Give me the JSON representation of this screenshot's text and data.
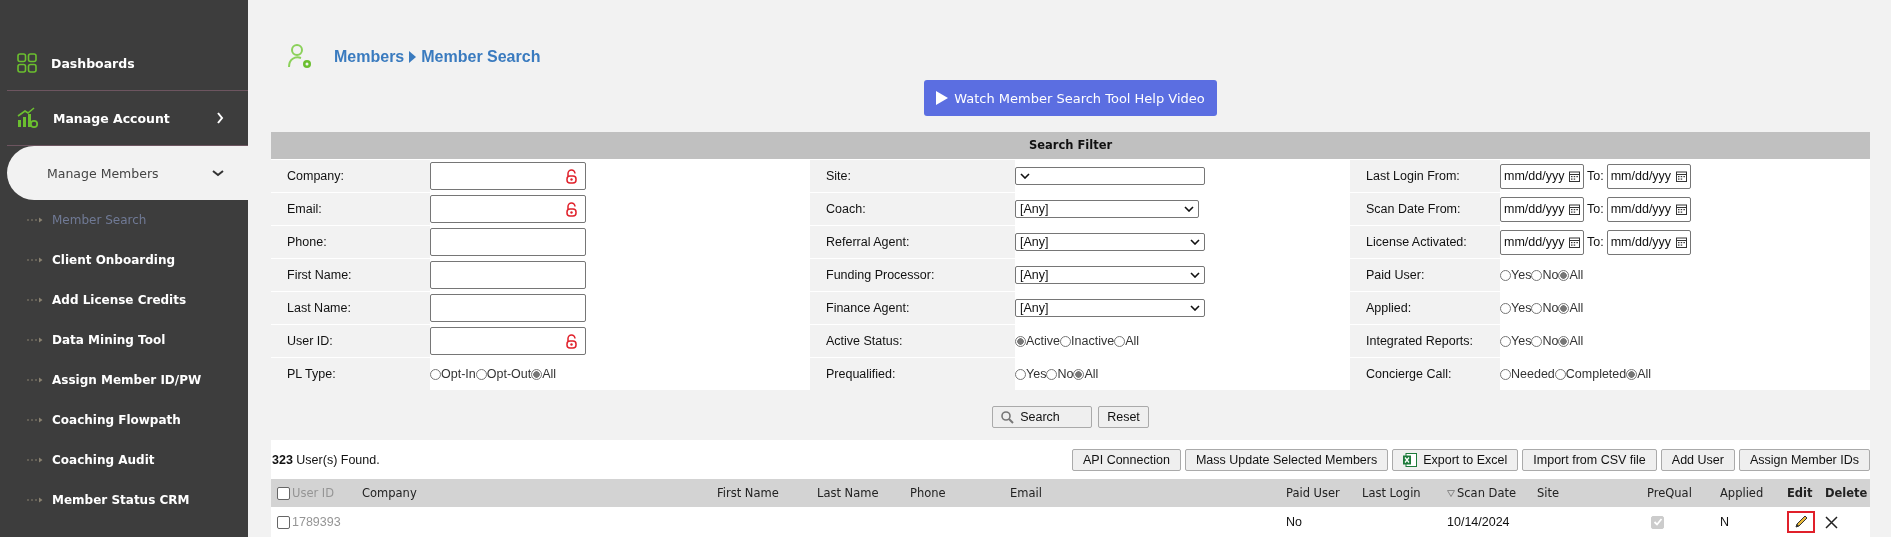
{
  "sidebar": {
    "items": [
      {
        "label": "Dashboards",
        "kind": "section"
      },
      {
        "label": "Manage Account",
        "kind": "section",
        "expanded": false
      },
      {
        "label": "Manage Members",
        "kind": "group",
        "expanded": true,
        "children": [
          {
            "label": "Member Search",
            "selected": true
          },
          {
            "label": "Client Onboarding",
            "selected": false
          },
          {
            "label": "Add License Credits",
            "selected": false
          },
          {
            "label": "Data Mining Tool",
            "selected": false
          },
          {
            "label": "Assign Member ID/PW",
            "selected": false
          },
          {
            "label": "Coaching Flowpath",
            "selected": false
          },
          {
            "label": "Coaching Audit",
            "selected": false
          },
          {
            "label": "Member Status CRM",
            "selected": false
          }
        ]
      }
    ]
  },
  "breadcrumb": [
    "Members",
    "Member Search"
  ],
  "help_button": "Watch Member Search Tool Help Video",
  "filter": {
    "title": "Search Filter",
    "rows": [
      [
        {
          "label": "Company:",
          "kind": "text",
          "locked": true
        },
        {
          "label": "Site:",
          "kind": "select"
        },
        {
          "label": "Last Login From:",
          "kind": "date",
          "placeholder": "mm/dd/yyy",
          "to_label": "To:",
          "to_placeholder": "mm/dd/yyy"
        }
      ],
      [
        {
          "label": "Email:",
          "kind": "text",
          "locked": true
        },
        {
          "label": "Coach:",
          "kind": "select",
          "value": "[Any]"
        },
        {
          "label": "Scan Date From:",
          "kind": "date",
          "placeholder": "mm/dd/yyy",
          "to_label": "To:",
          "to_placeholder": "mm/dd/yyy"
        }
      ],
      [
        {
          "label": "Phone:",
          "kind": "text",
          "locked": false
        },
        {
          "label": "Referral Agent:",
          "kind": "select",
          "value": "[Any]"
        },
        {
          "label": "License Activated:",
          "kind": "date",
          "placeholder": "mm/dd/yyy",
          "to_label": "To:",
          "to_placeholder": "mm/dd/yyy"
        }
      ],
      [
        {
          "label": "First Name:",
          "kind": "text",
          "locked": false
        },
        {
          "label": "Funding Processor:",
          "kind": "select",
          "value": "[Any]"
        },
        {
          "label": "Paid User:",
          "kind": "radio",
          "options": [
            {
              "label": "Yes",
              "selected": false
            },
            {
              "label": "No",
              "selected": false
            },
            {
              "label": "All",
              "selected": true
            }
          ]
        }
      ],
      [
        {
          "label": "Last Name:",
          "kind": "text",
          "locked": false
        },
        {
          "label": "Finance Agent:",
          "kind": "select",
          "value": "[Any]"
        },
        {
          "label": "Applied:",
          "kind": "radio",
          "options": [
            {
              "label": "Yes",
              "selected": false
            },
            {
              "label": "No",
              "selected": false
            },
            {
              "label": "All",
              "selected": true
            }
          ]
        }
      ],
      [
        {
          "label": "User ID:",
          "kind": "text",
          "locked": true
        },
        {
          "label": "Active Status:",
          "kind": "radio",
          "options": [
            {
              "label": "Active",
              "selected": true
            },
            {
              "label": "Inactive",
              "selected": false
            },
            {
              "label": "All",
              "selected": false
            }
          ]
        },
        {
          "label": "Integrated Reports:",
          "kind": "radio",
          "options": [
            {
              "label": "Yes",
              "selected": false
            },
            {
              "label": "No",
              "selected": false
            },
            {
              "label": "All",
              "selected": true
            }
          ]
        }
      ],
      [
        {
          "label": "PL Type:",
          "kind": "radio",
          "options": [
            {
              "label": "Opt-In",
              "selected": false
            },
            {
              "label": "Opt-Out",
              "selected": false
            },
            {
              "label": "All",
              "selected": true
            }
          ]
        },
        {
          "label": "Prequalified:",
          "kind": "radio",
          "options": [
            {
              "label": "Yes",
              "selected": false
            },
            {
              "label": "No",
              "selected": false
            },
            {
              "label": "All",
              "selected": true
            }
          ]
        },
        {
          "label": "Concierge Call:",
          "kind": "radio",
          "options": [
            {
              "label": "Needed",
              "selected": false
            },
            {
              "label": "Completed",
              "selected": false
            },
            {
              "label": "All",
              "selected": true
            }
          ]
        }
      ]
    ],
    "search_button": "Search",
    "reset_button": "Reset"
  },
  "results": {
    "count": "323",
    "text": "User(s) Found."
  },
  "toolbar": [
    {
      "label": "API Connection",
      "kind": "plain"
    },
    {
      "label": "Mass Update Selected Members",
      "kind": "plain"
    },
    {
      "label": "Export to Excel",
      "kind": "excel"
    },
    {
      "label": "Import from CSV file",
      "kind": "plain"
    },
    {
      "label": "Add User",
      "kind": "plain"
    },
    {
      "label": "Assign Member IDs",
      "kind": "plain"
    }
  ],
  "table": {
    "select_all": false,
    "columns": [
      {
        "label": "User ID",
        "dim": true
      },
      {
        "label": "Company"
      },
      {
        "label": "First Name"
      },
      {
        "label": "Last Name"
      },
      {
        "label": "Phone"
      },
      {
        "label": "Email"
      },
      {
        "label": "Paid User"
      },
      {
        "label": "Last Login"
      },
      {
        "label": "Scan Date",
        "sorted": true
      },
      {
        "label": "Site"
      },
      {
        "label": "PreQual",
        "kind": "check"
      },
      {
        "label": "Applied"
      },
      {
        "label": "Edit",
        "kind": "edit",
        "bold": true
      },
      {
        "label": "Delete",
        "kind": "delete",
        "bold": true
      }
    ],
    "rows": [
      {
        "checked": false,
        "user_id": "1789393",
        "paid_user": "No",
        "scan_date": "10/14/2024",
        "prequal": true,
        "applied": "N"
      }
    ]
  }
}
